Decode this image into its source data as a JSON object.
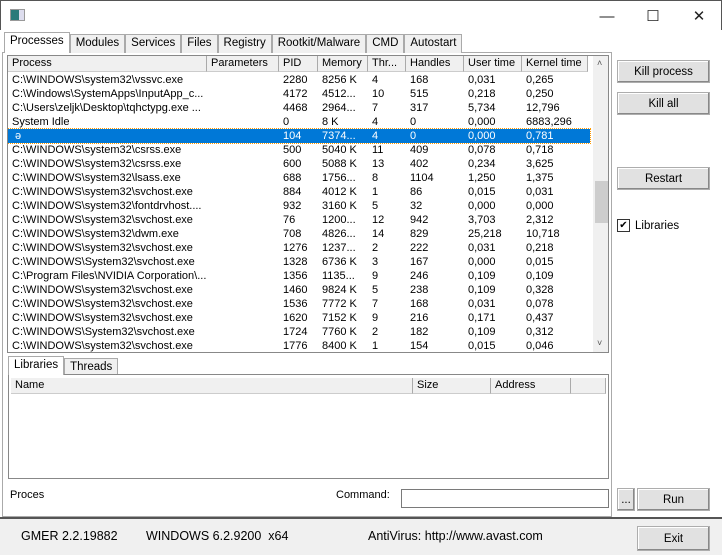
{
  "window": {
    "minimize": "—",
    "maximize": "☐",
    "close": "✕"
  },
  "tabs": [
    "Processes",
    "Modules",
    "Services",
    "Files",
    "Registry",
    "Rootkit/Malware",
    "CMD",
    "Autostart"
  ],
  "columns": [
    "Process",
    "Parameters",
    "PID",
    "Memory",
    "Thr...",
    "Handles",
    "User time",
    "Kernel time"
  ],
  "rows": [
    [
      "C:\\WINDOWS\\system32\\vssvc.exe",
      "",
      "2280",
      "8256 K",
      "4",
      "168",
      "0,031",
      "0,265"
    ],
    [
      "C:\\Windows\\SystemApps\\InputApp_c...",
      "",
      "4172",
      "4512...",
      "10",
      "515",
      "0,218",
      "0,250"
    ],
    [
      "C:\\Users\\zeljk\\Desktop\\tqhctypg.exe ...",
      "",
      "4468",
      "2964...",
      "7",
      "317",
      "5,734",
      "12,796"
    ],
    [
      "System Idle",
      "",
      "0",
      "8 K",
      "4",
      "0",
      "0,000",
      "6883,296"
    ],
    [
      " ə",
      "",
      "104",
      "7374...",
      "4",
      "0",
      "0,000",
      "0,781"
    ],
    [
      "C:\\WINDOWS\\system32\\csrss.exe",
      "",
      "500",
      "5040 K",
      "11",
      "409",
      "0,078",
      "0,718"
    ],
    [
      "C:\\WINDOWS\\system32\\csrss.exe",
      "",
      "600",
      "5088 K",
      "13",
      "402",
      "0,234",
      "3,625"
    ],
    [
      "C:\\WINDOWS\\system32\\lsass.exe",
      "",
      "688",
      "1756...",
      "8",
      "1104",
      "1,250",
      "1,375"
    ],
    [
      "C:\\WINDOWS\\system32\\svchost.exe",
      "",
      "884",
      "4012 K",
      "1",
      "86",
      "0,015",
      "0,031"
    ],
    [
      "C:\\WINDOWS\\system32\\fontdrvhost....",
      "",
      "932",
      "3160 K",
      "5",
      "32",
      "0,000",
      "0,000"
    ],
    [
      "C:\\WINDOWS\\system32\\svchost.exe",
      "",
      "76",
      "1200...",
      "12",
      "942",
      "3,703",
      "2,312"
    ],
    [
      "C:\\WINDOWS\\system32\\dwm.exe",
      "",
      "708",
      "4826...",
      "14",
      "829",
      "25,218",
      "10,718"
    ],
    [
      "C:\\WINDOWS\\system32\\svchost.exe",
      "",
      "1276",
      "1237...",
      "2",
      "222",
      "0,031",
      "0,218"
    ],
    [
      "C:\\WINDOWS\\System32\\svchost.exe",
      "",
      "1328",
      "6736 K",
      "3",
      "167",
      "0,000",
      "0,015"
    ],
    [
      "C:\\Program Files\\NVIDIA Corporation\\...",
      "",
      "1356",
      "1135...",
      "9",
      "246",
      "0,109",
      "0,109"
    ],
    [
      "C:\\WINDOWS\\system32\\svchost.exe",
      "",
      "1460",
      "9824 K",
      "5",
      "238",
      "0,109",
      "0,328"
    ],
    [
      "C:\\WINDOWS\\system32\\svchost.exe",
      "",
      "1536",
      "7772 K",
      "7",
      "168",
      "0,031",
      "0,078"
    ],
    [
      "C:\\WINDOWS\\system32\\svchost.exe",
      "",
      "1620",
      "7152 K",
      "9",
      "216",
      "0,171",
      "0,437"
    ],
    [
      "C:\\WINDOWS\\System32\\svchost.exe",
      "",
      "1724",
      "7760 K",
      "2",
      "182",
      "0,109",
      "0,312"
    ],
    [
      "C:\\WINDOWS\\system32\\svchost.exe",
      "",
      "1776",
      "8400 K",
      "1",
      "154",
      "0,015",
      "0,046"
    ]
  ],
  "selected_row": 4,
  "lower_tabs": [
    "Libraries",
    "Threads"
  ],
  "lower_columns": [
    "Name",
    "Size",
    "Address"
  ],
  "right": {
    "kill_process": "Kill process",
    "kill_all": "Kill all",
    "restart": "Restart",
    "libraries_label": "Libraries",
    "libraries_checked": true,
    "check": "✔"
  },
  "cmd": {
    "status": "Proces",
    "command_label": "Command:",
    "command_value": "",
    "browse": "...",
    "run": "Run"
  },
  "statusbar": {
    "version": "GMER 2.2.19882",
    "os": "WINDOWS 6.2.9200  x64",
    "antivirus": "AntiVirus: http://www.avast.com",
    "exit": "Exit"
  },
  "colors": {
    "selection": "#0078d7"
  }
}
